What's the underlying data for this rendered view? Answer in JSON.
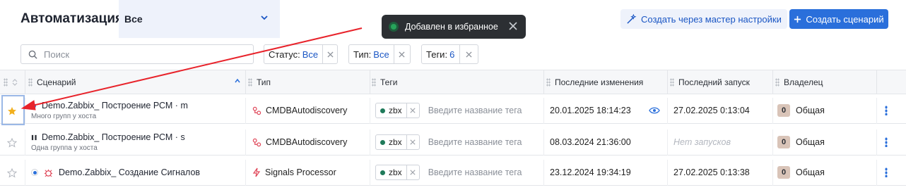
{
  "header": {
    "title": "Автоматизация",
    "scope_value": "Все",
    "wizard_button": "Создать через мастер настройки",
    "create_button": "Создать сценарий"
  },
  "toast": {
    "message": "Добавлен в избранное"
  },
  "filters": {
    "search_placeholder": "Поиск",
    "status": {
      "label": "Статус:",
      "value": "Все"
    },
    "type": {
      "label": "Тип:",
      "value": "Все"
    },
    "tags": {
      "label": "Теги:",
      "value": "6"
    }
  },
  "table": {
    "columns": [
      "Сценарий",
      "Тип",
      "Теги",
      "Последние изменения",
      "Последний запуск",
      "Владелец"
    ],
    "rows": [
      {
        "favorite": true,
        "name": "Demo.Zabbix_ Построение РСМ · m",
        "subtitle": "Много групп у хоста",
        "type": "CMDBAutodiscovery",
        "tag": "zbx",
        "tag_placeholder": "Введите название тега",
        "last_change": "20.01.2025 18:14:23",
        "last_run": "27.02.2025 0:13:04",
        "owner_count": "0",
        "owner": "Общая"
      },
      {
        "favorite": false,
        "name": "Demo.Zabbix_ Построение РСМ · s",
        "subtitle": "Одна группа у хоста",
        "type": "CMDBAutodiscovery",
        "tag": "zbx",
        "tag_placeholder": "Введите название тега",
        "last_change": "08.03.2024 21:36:00",
        "last_run": "Нет запусков",
        "owner_count": "0",
        "owner": "Общая"
      },
      {
        "favorite": false,
        "name": "Demo.Zabbix_ Создание Сигналов",
        "subtitle": "",
        "type": "Signals Processor",
        "tag": "zbx",
        "tag_placeholder": "Введите название тега",
        "last_change": "23.12.2024 19:34:19",
        "last_run": "27.02.2025 0:13:38",
        "owner_count": "0",
        "owner": "Общая"
      }
    ]
  },
  "colors": {
    "accent": "#2a6fdb",
    "star_active": "#f2b01e",
    "annotation_arrow": "#e8232b"
  }
}
